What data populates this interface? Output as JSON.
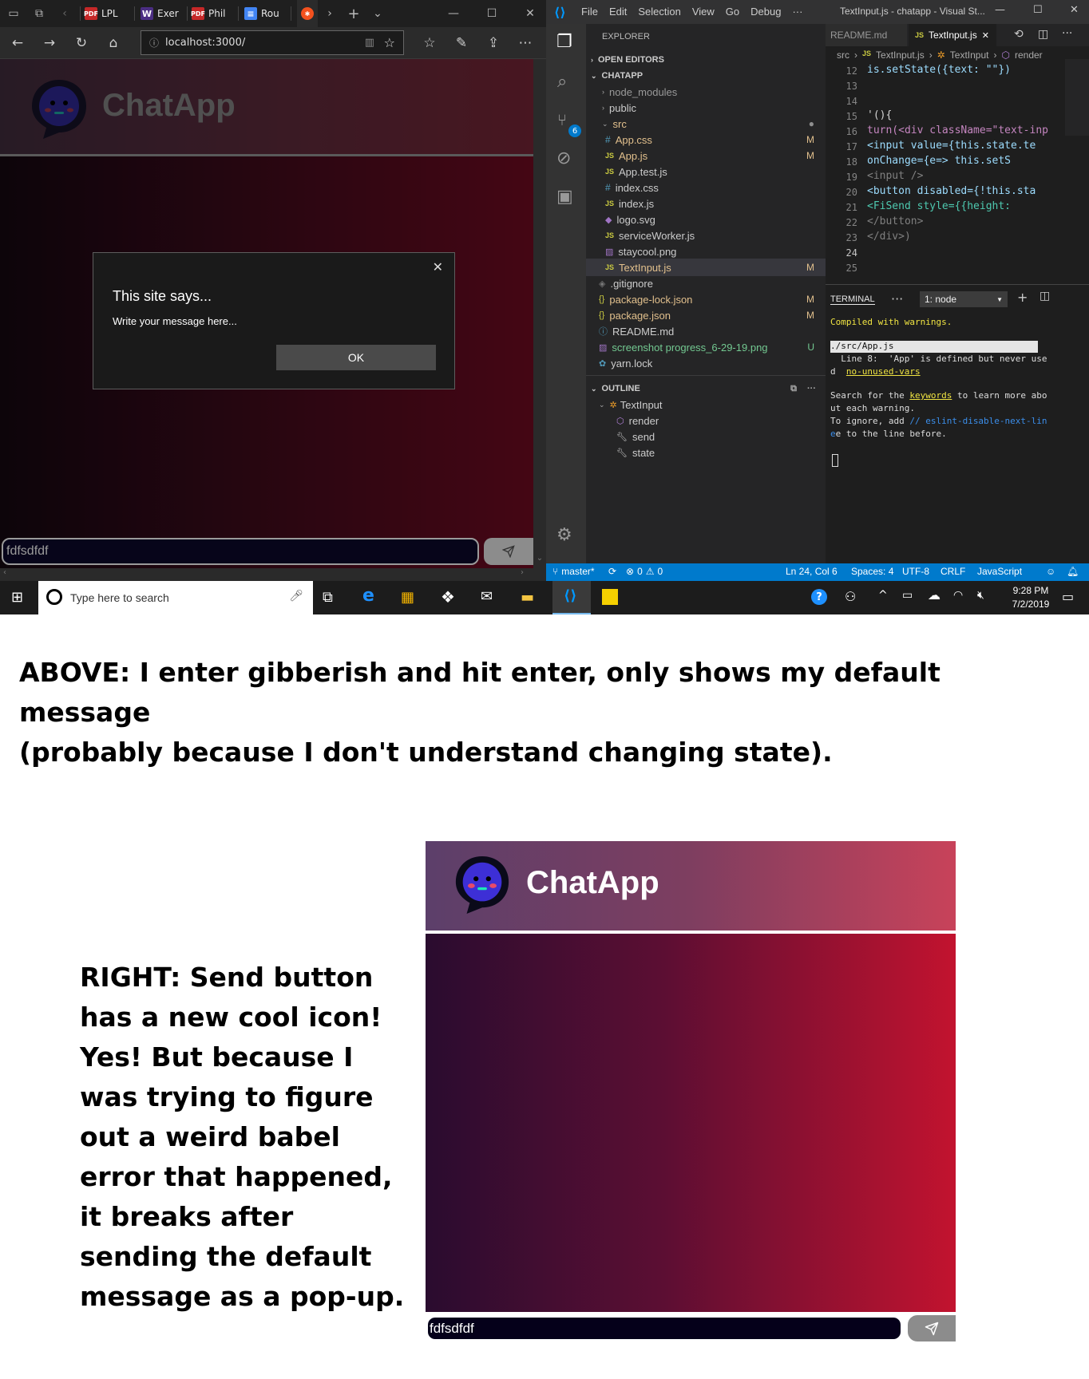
{
  "edge": {
    "tabs": [
      "LPL",
      "Exer",
      "Phil",
      "Rou"
    ],
    "url": "localhost:3000/",
    "app_title": "ChatApp",
    "input_value": "fdfsdfdf",
    "dialog": {
      "title": "This site says...",
      "message": "Write your message here...",
      "ok_label": "OK"
    }
  },
  "vscode": {
    "menu": [
      "File",
      "Edit",
      "Selection",
      "View",
      "Go",
      "Debug",
      "···"
    ],
    "window_title": "TextInput.js - chatapp - Visual St...",
    "tabs": [
      "README.md",
      "TextInput.js"
    ],
    "breadcrumb": [
      "src",
      "TextInput.js",
      "TextInput",
      "render"
    ],
    "explorer_title": "EXPLORER",
    "open_editors": "OPEN EDITORS",
    "project": "CHATAPP",
    "scm_badge": "6",
    "files": [
      {
        "name": "node_modules",
        "badge": ""
      },
      {
        "name": "public",
        "badge": ""
      },
      {
        "name": "src",
        "badge": ""
      },
      {
        "name": "App.css",
        "badge": "M"
      },
      {
        "name": "App.js",
        "badge": "M"
      },
      {
        "name": "App.test.js",
        "badge": ""
      },
      {
        "name": "index.css",
        "badge": ""
      },
      {
        "name": "index.js",
        "badge": ""
      },
      {
        "name": "logo.svg",
        "badge": ""
      },
      {
        "name": "serviceWorker.js",
        "badge": ""
      },
      {
        "name": "staycool.png",
        "badge": ""
      },
      {
        "name": "TextInput.js",
        "badge": "M"
      },
      {
        "name": ".gitignore",
        "badge": ""
      },
      {
        "name": "package-lock.json",
        "badge": "M"
      },
      {
        "name": "package.json",
        "badge": "M"
      },
      {
        "name": "README.md",
        "badge": ""
      },
      {
        "name": "screenshot progress_6-29-19.png",
        "badge": "U"
      },
      {
        "name": "yarn.lock",
        "badge": ""
      }
    ],
    "outline_title": "OUTLINE",
    "outline": [
      "TextInput",
      "render",
      "send",
      "state"
    ],
    "code_lines": [
      {
        "n": "12",
        "t": "is.setState({text: \"\"})"
      },
      {
        "n": "13",
        "t": ""
      },
      {
        "n": "14",
        "t": ""
      },
      {
        "n": "15",
        "t": "'(){"
      },
      {
        "n": "16",
        "t": "turn(<div className=\"text-inp"
      },
      {
        "n": "17",
        "t": "  <input value={this.state.te"
      },
      {
        "n": "18",
        "t": "    onChange={e=> this.setS"
      },
      {
        "n": "19",
        "t": "  <input />"
      },
      {
        "n": "20",
        "t": "  <button disabled={!this.sta"
      },
      {
        "n": "21",
        "t": "    <FiSend style={{height:"
      },
      {
        "n": "22",
        "t": "  </button>"
      },
      {
        "n": "23",
        "t": "  </div>)"
      },
      {
        "n": "24",
        "t": ""
      },
      {
        "n": "25",
        "t": ""
      }
    ],
    "terminal": {
      "tab": "TERMINAL",
      "dropdown": "1: node",
      "compiled": "Compiled with warnings.",
      "file": "./src/App.js",
      "warn1": "  Line 8:  'App' is defined but never use",
      "warn2a": "d  ",
      "warn2b": "no-unused-vars",
      "search1a": "Search for the ",
      "search1b": "keywords",
      "search1c": " to learn more abo",
      "search2": "ut each warning.",
      "ignore1a": "To ignore, add ",
      "ignore1b": "// eslint-disable-next-lin",
      "ignore2": "e to the line before."
    },
    "status": {
      "branch": "master*",
      "errors": "0",
      "warnings": "0",
      "position": "Ln 24, Col 6",
      "spaces": "Spaces: 4",
      "encoding": "UTF-8",
      "eol": "CRLF",
      "language": "JavaScript"
    }
  },
  "taskbar": {
    "search_placeholder": "Type here to search",
    "time": "9:28 PM",
    "date": "7/2/2019"
  },
  "annotations": {
    "above": [
      "ABOVE: I enter gibberish and hit enter, only shows my default",
      "message",
      "(probably because I don't understand changing state)."
    ],
    "right": [
      "RIGHT: Send button",
      "has a new cool icon!",
      "Yes! But because I",
      "was trying to figure",
      "out a weird babel",
      "error that happened,",
      "it breaks after",
      "sending the default",
      "message as a pop-up."
    ]
  },
  "chat": {
    "title": "ChatApp",
    "input_value": "fdfsdfdf"
  }
}
